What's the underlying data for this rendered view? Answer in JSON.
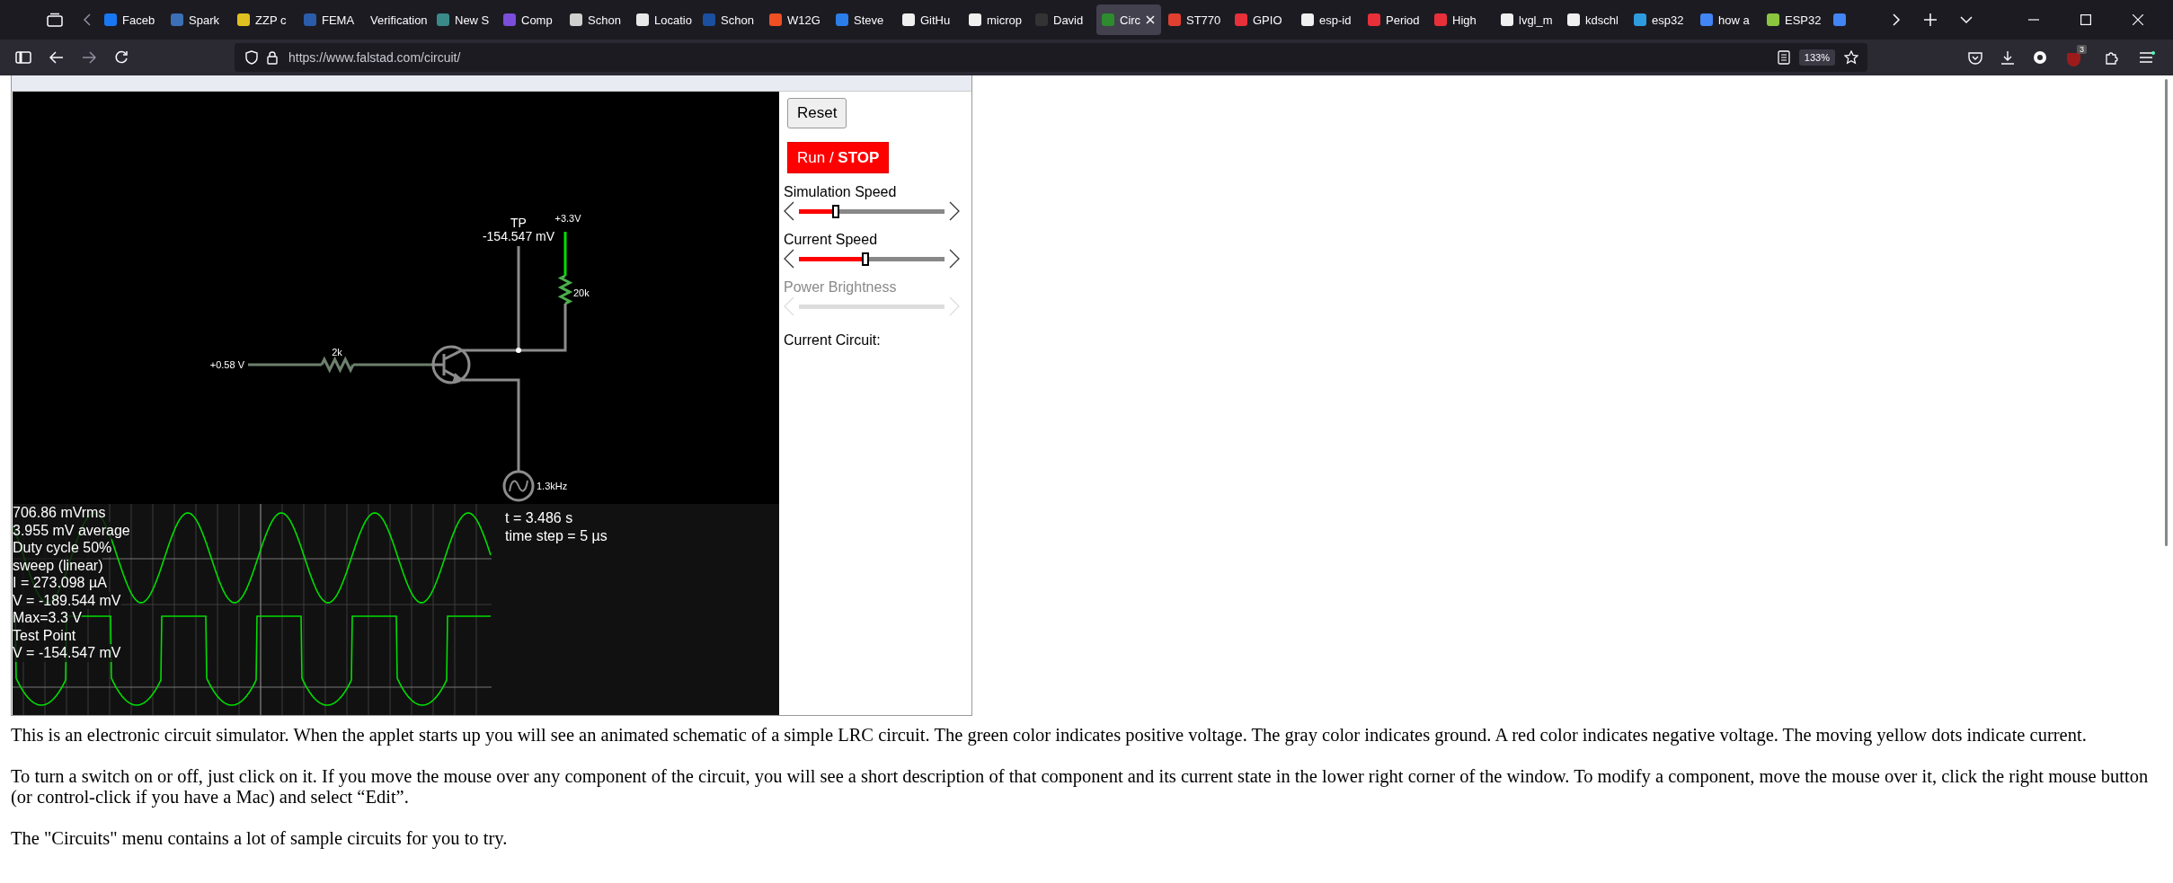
{
  "browser": {
    "tabs": [
      {
        "label": "Faceb",
        "color": "#1877f2",
        "selected": false
      },
      {
        "label": "Spark",
        "color": "#3b6fb6",
        "selected": false
      },
      {
        "label": "ZZP c",
        "color": "#e0c020",
        "selected": false
      },
      {
        "label": "FEMA",
        "color": "#2a5caa",
        "selected": false
      },
      {
        "label": "Verification",
        "selected": false
      },
      {
        "label": "New S",
        "color": "#3a8a8a",
        "selected": false
      },
      {
        "label": "Comp",
        "color": "#7b4ddb",
        "selected": false
      },
      {
        "label": "Schon",
        "color": "#d0d0d0",
        "selected": false
      },
      {
        "label": "Locatio",
        "color": "#e8e8e8",
        "selected": false
      },
      {
        "label": "Schon",
        "color": "#1b4fa0",
        "selected": false
      },
      {
        "label": "W12G",
        "color": "#f04e23",
        "selected": false
      },
      {
        "label": "Steve",
        "color": "#2b7de9",
        "selected": false
      },
      {
        "label": "GitHu",
        "color": "#f0f0f0",
        "selected": false
      },
      {
        "label": "microp",
        "color": "#f0f0f0",
        "selected": false
      },
      {
        "label": "David",
        "color": "#333333",
        "selected": false
      },
      {
        "label": "Circ",
        "color": "#2e8b2e",
        "selected": true
      },
      {
        "label": "ST770",
        "color": "#e04030",
        "selected": false
      },
      {
        "label": "GPIO",
        "color": "#e8303a",
        "selected": false
      },
      {
        "label": "esp-id",
        "color": "#f0f0f0",
        "selected": false
      },
      {
        "label": "Period",
        "color": "#e8303a",
        "selected": false
      },
      {
        "label": "High",
        "color": "#e8303a",
        "selected": false
      },
      {
        "label": "lvgl_m",
        "color": "#f0f0f0",
        "selected": false
      },
      {
        "label": "kdschl",
        "color": "#f0f0f0",
        "selected": false
      },
      {
        "label": "esp32",
        "color": "#2e9be0",
        "selected": false
      },
      {
        "label": "how a",
        "color": "#4285f4",
        "selected": false
      },
      {
        "label": "ESP32",
        "color": "#8cc63f",
        "selected": false
      },
      {
        "color": "#4285f4",
        "selected": false
      }
    ],
    "url": "https://www.falstad.com/circuit/",
    "zoom": "133%",
    "extension_badge": "3"
  },
  "circuit": {
    "tp_label": "TP",
    "tp_value": "-154.547 mV",
    "supply_label": "+3.3V",
    "collector_resistor": "20k",
    "base_resistor": "2k",
    "input_label": "+0.58 V",
    "source_label": "1.3kHz"
  },
  "scope": {
    "readouts": [
      "706.86 mVrms",
      "3.955 mV average",
      "Duty cycle 50%",
      "sweep (linear)",
      "I = 273.098 µA",
      "V = -189.544 mV",
      "Max=3.3 V",
      "Test Point",
      "V = -154.547 mV"
    ],
    "info": [
      "t = 3.486 s",
      "time step = 5 µs"
    ]
  },
  "controls": {
    "reset_button": "Reset",
    "run_button": "Run / **STOP**",
    "sliders": [
      {
        "label": "Simulation Speed",
        "level": 0.26,
        "disabled": false
      },
      {
        "label": "Current Speed",
        "level": 0.46,
        "disabled": false
      },
      {
        "label": "Power Brightness",
        "disabled": true
      }
    ],
    "current_circuit_label": "Current Circuit:"
  },
  "description": [
    "This is an electronic circuit simulator.  When the applet starts up you will see an animated schematic of a simple LRC circuit. The green color indicates positive voltage.  The gray color indicates ground.  A red color indicates negative voltage.  The moving yellow dots indicate current.",
    "To turn a switch on or off, just click on it.  If you move the mouse over any component of the circuit, you will see a short description of that component and its current state in the lower right corner of the window.  To modify a component, move the mouse over it, click the right mouse button (or control-click if you have a Mac) and select “Edit”.",
    "The \"Circuits\" menu contains a lot of sample circuits for you to try."
  ]
}
